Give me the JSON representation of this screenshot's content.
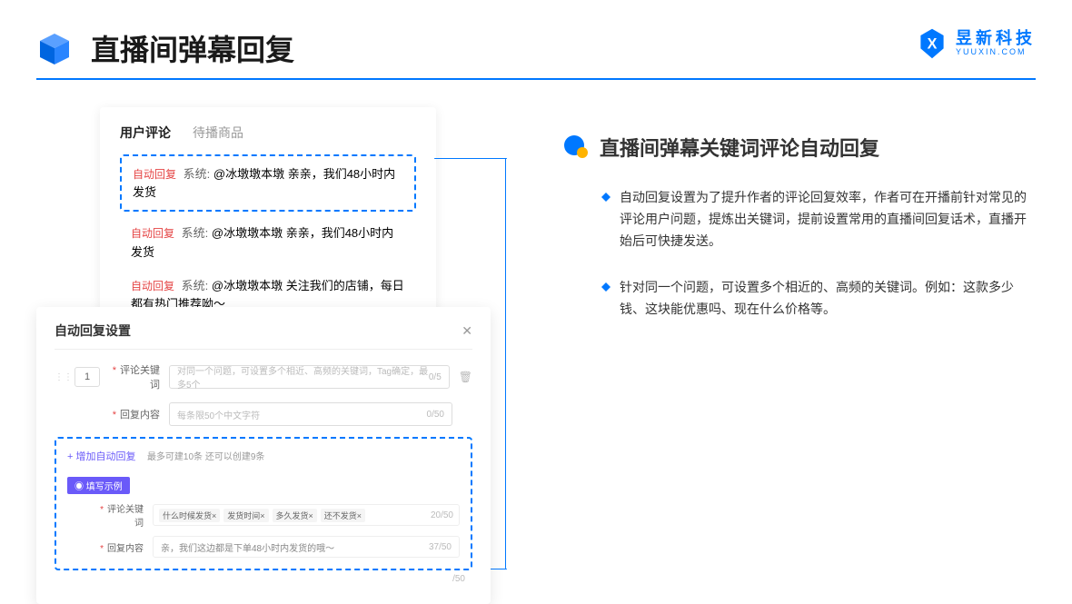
{
  "header": {
    "title": "直播间弹幕回复",
    "brand_cn": "昱新科技",
    "brand_en": "YUUXIN.COM"
  },
  "card1": {
    "tab_active": "用户评论",
    "tab_inactive": "待播商品",
    "auto_tag": "自动回复",
    "sys_label": "系统:",
    "highlighted": "@冰墩墩本墩 亲亲，我们48小时内发货",
    "row2": "@冰墩墩本墩 亲亲，我们48小时内发货",
    "row3": "@冰墩墩本墩 关注我们的店铺，每日都有热门推荐呦～"
  },
  "card2": {
    "title": "自动回复设置",
    "seq": "1",
    "label_keyword": "评论关键词",
    "placeholder_keyword": "对同一个问题，可设置多个相近、高频的关键词，Tag确定，最多5个",
    "count_keyword": "0/5",
    "label_content": "回复内容",
    "placeholder_content": "每条限50个中文字符",
    "count_content": "0/50",
    "add_link": "+ 增加自动回复",
    "add_hint": "最多可建10条 还可以创建9条",
    "example_badge": "◉ 填写示例",
    "ex_label_keyword": "评论关键词",
    "ex_tags": [
      "什么时候发货×",
      "发货时间×",
      "多久发货×",
      "还不发货×"
    ],
    "ex_count_keyword": "20/50",
    "ex_label_content": "回复内容",
    "ex_content": "亲，我们这边都是下单48小时内发货的哦～",
    "ex_count_content": "37/50",
    "ex_count_extra": "/50"
  },
  "right": {
    "section_title": "直播间弹幕关键词评论自动回复",
    "bullet1": "自动回复设置为了提升作者的评论回复效率，作者可在开播前针对常见的评论用户问题，提炼出关键词，提前设置常用的直播间回复话术，直播开始后可快捷发送。",
    "bullet2": "针对同一个问题，可设置多个相近的、高频的关键词。例如：这款多少钱、这块能优惠吗、现在什么价格等。"
  }
}
